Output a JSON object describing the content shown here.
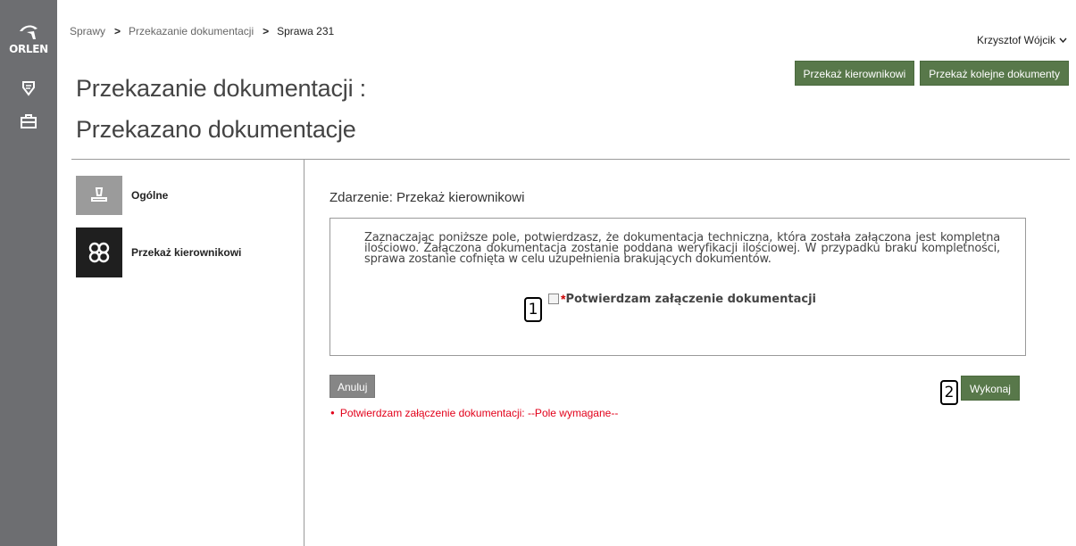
{
  "brand": {
    "logo_text": "ORLEN"
  },
  "breadcrumb": {
    "items": [
      "Sprawy",
      "Przekazanie dokumentacji",
      "Sprawa 231"
    ],
    "separator": ">"
  },
  "user": {
    "name": "Krzysztof Wójcik",
    "chevron": "⌄"
  },
  "top_actions": {
    "forward_manager": "Przekaż kierownikowi",
    "forward_next_docs": "Przekaż kolejne dokumenty"
  },
  "heading": {
    "line1": "Przekazanie dokumentacji :",
    "line2": "Przekazano dokumentacje"
  },
  "steps": [
    {
      "label": "Ogólne",
      "icon": "stamp-icon"
    },
    {
      "label": "Przekaż kierownikowi",
      "icon": "molecule-icon"
    }
  ],
  "event": {
    "title": "Zdarzenie: Przekaż kierownikowi",
    "description": "Zaznaczając poniższe pole, potwierdzasz, że dokumentacja techniczna, która została załączona jest kompletna ilościowo. Załączona dokumentacja zostanie poddana weryfikacji ilościowej. W przypadku braku kompletności, sprawa zostanie cofnięta w celu uzupełnienia brakujących dokumentów.",
    "checkbox": {
      "required_mark": "*",
      "label": "Potwierdzam załączenie dokumentacji",
      "checked": false
    }
  },
  "buttons": {
    "cancel": "Anuluj",
    "execute": "Wykonaj"
  },
  "callouts": [
    "1",
    "2"
  ],
  "errors": [
    "Potwierdzam załączenie dokumentacji: --Pole wymagane--"
  ],
  "colors": {
    "rail": "#6d6e71",
    "accent_green": "#58784a",
    "error_red": "#e2001a"
  }
}
